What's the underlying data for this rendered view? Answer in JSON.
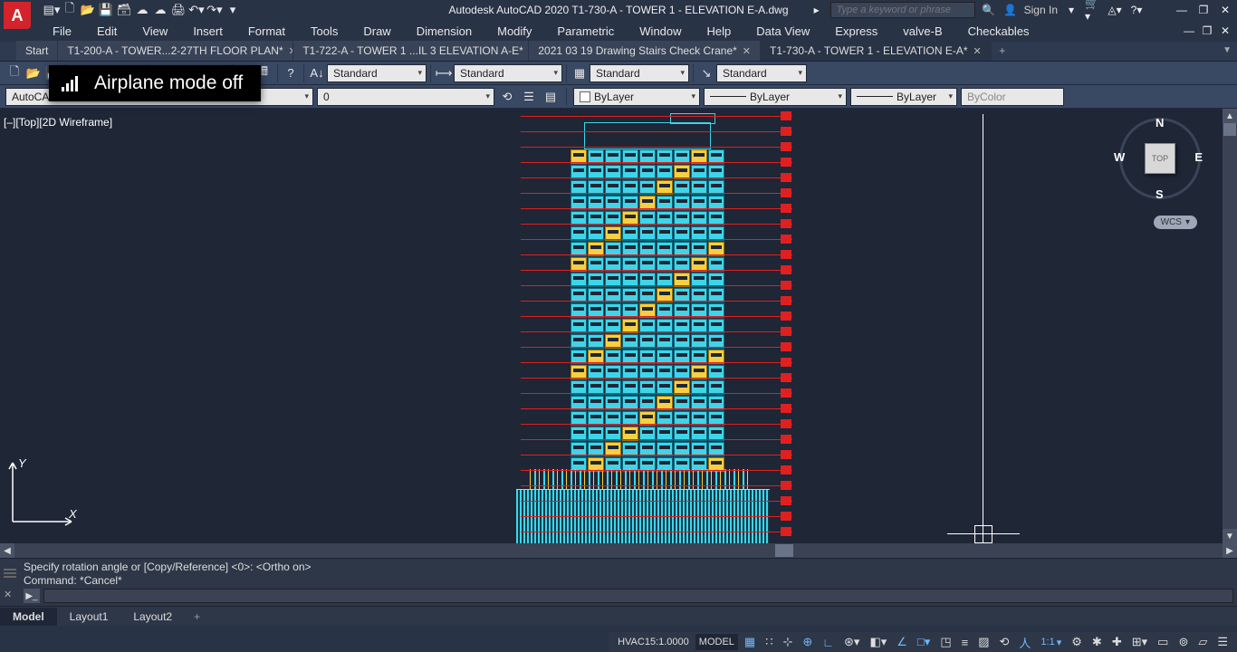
{
  "app": {
    "title": "Autodesk AutoCAD 2020   T1-730-A - TOWER 1 - ELEVATION E-A.dwg"
  },
  "search": {
    "placeholder": "Type a keyword or phrase"
  },
  "signin": {
    "label": "Sign In"
  },
  "menu": [
    "File",
    "Edit",
    "View",
    "Insert",
    "Format",
    "Tools",
    "Draw",
    "Dimension",
    "Modify",
    "Parametric",
    "Window",
    "Help",
    "Data View",
    "Express",
    "valve-B",
    "Checkables"
  ],
  "tabs": [
    {
      "label": "Start",
      "close": false
    },
    {
      "label": "T1-200-A - TOWER...2-27TH FLOOR PLAN*",
      "close": true
    },
    {
      "label": "T1-722-A - TOWER 1 ...IL 3 ELEVATION A-E*",
      "close": true
    },
    {
      "label": "2021 03 19 Drawing Stairs Check Crane*",
      "close": true
    },
    {
      "label": "T1-730-A - TOWER 1 - ELEVATION E-A*",
      "close": true,
      "active": true
    }
  ],
  "styles": {
    "text": "Standard",
    "dim": "Standard",
    "table": "Standard",
    "ml": "Standard"
  },
  "layer": {
    "name": "0",
    "color": "ByLayer",
    "ltype": "ByLayer",
    "lweight": "ByLayer",
    "plot": "ByColor"
  },
  "autocad_combo": "AutoCAD",
  "viewport_label": "[–][Top][2D Wireframe]",
  "viewcube": {
    "n": "N",
    "s": "S",
    "e": "E",
    "w": "W",
    "face": "TOP"
  },
  "wcs": "WCS",
  "ucs": {
    "x": "X",
    "y": "Y"
  },
  "cmd": {
    "line1": "Specify rotation angle or [Copy/Reference] <0>:  <Ortho on>",
    "line2": "Command: *Cancel*"
  },
  "layout_tabs": [
    "Model",
    "Layout1",
    "Layout2"
  ],
  "status": {
    "coord": "HVAC15:1.0000",
    "space": "MODEL",
    "scale": "1:1"
  },
  "notification": "Airplane mode off"
}
